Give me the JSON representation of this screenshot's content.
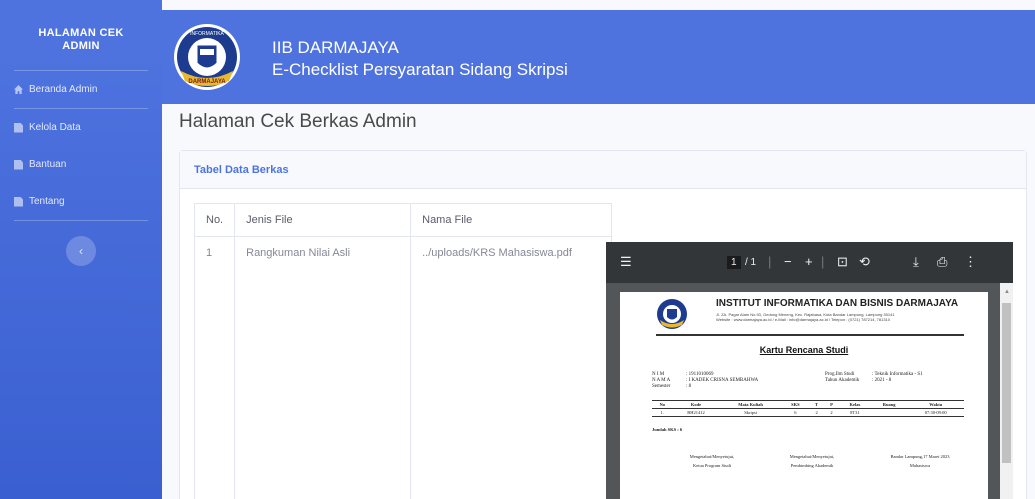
{
  "sidebar": {
    "brand_line1": "HALAMAN CEK",
    "brand_line2": "ADMIN",
    "items": [
      {
        "label": "Beranda Admin",
        "icon": "home-icon"
      },
      {
        "label": "Kelola Data",
        "icon": "file-icon"
      },
      {
        "label": "Bantuan",
        "icon": "file-icon"
      },
      {
        "label": "Tentang",
        "icon": "file-icon"
      }
    ],
    "toggle_glyph": "‹"
  },
  "topbar": {
    "title": "IIB DARMAJAYA",
    "subtitle": "E-Checklist Persyaratan Sidang Skripsi",
    "logo_text_top": "INFORMATIKA",
    "logo_text_bottom": "DARMAJAYA"
  },
  "page": {
    "heading": "Halaman Cek Berkas Admin"
  },
  "card": {
    "title": "Tabel Data Berkas",
    "columns": [
      "No.",
      "Jenis File",
      "Nama File"
    ],
    "rows": [
      {
        "no": "1",
        "jenis": "Rangkuman Nilai Asli",
        "nama": "../uploads/KRS Mahasiswa.pdf"
      }
    ]
  },
  "pdf_viewer": {
    "page_current": "1",
    "page_total": "/ 1",
    "document": {
      "institution": "INSTITUT INFORMATIKA DAN BISNIS DARMAJAYA",
      "address": "Jl. ZA. Pagar Alam No.93, Gedong Meneng, Kec. Rajabasa, Kota Bandar Lampung, Lampung 35141",
      "contact": "Website : www.darmajaya.ac.id / e-Mail : info@darmajaya.ac.id / Telepon : (0721) 787214, 781310",
      "title": "Kartu Rencana Studi",
      "nim_label": "N I M",
      "nim": ": 1911010069",
      "nama_label": "N A M A",
      "nama": ": I KADEK CRISNA SEMBAHWA",
      "semester_label": "Semester",
      "semester": ": 8",
      "prodi_label": "Prog.Ilm Studi",
      "prodi": ": Teknik Informatika - S1",
      "tahun_label": "Tahun Akademik",
      "tahun": ": 2021 - 8",
      "table_headers": [
        "No",
        "Kode",
        "Mata Kuliah",
        "SKS",
        "T",
        "P",
        "Kelas",
        "Ruang",
        "Waktu"
      ],
      "table_row": [
        "1.",
        "BH21412",
        "Skripsi",
        "6",
        "2",
        "2",
        "8T31",
        "",
        "07:30-09:00"
      ],
      "jumlah_sks": "Jumlah SKS : 6",
      "sig1_line1": "Mengetahui/Menyetujui,",
      "sig1_line2": "Ketua Program Studi",
      "sig2_line1": "Mengetahui/Menyetujui,",
      "sig2_line2": "Pembimbing Akademik",
      "sig3_line1": "Bandar Lampung,17 Maret 2023",
      "sig3_line2": "Mahasiswa"
    }
  },
  "colors": {
    "primary": "#4e73df",
    "pdf_toolbar": "#323639",
    "pdf_bg": "#525659"
  }
}
